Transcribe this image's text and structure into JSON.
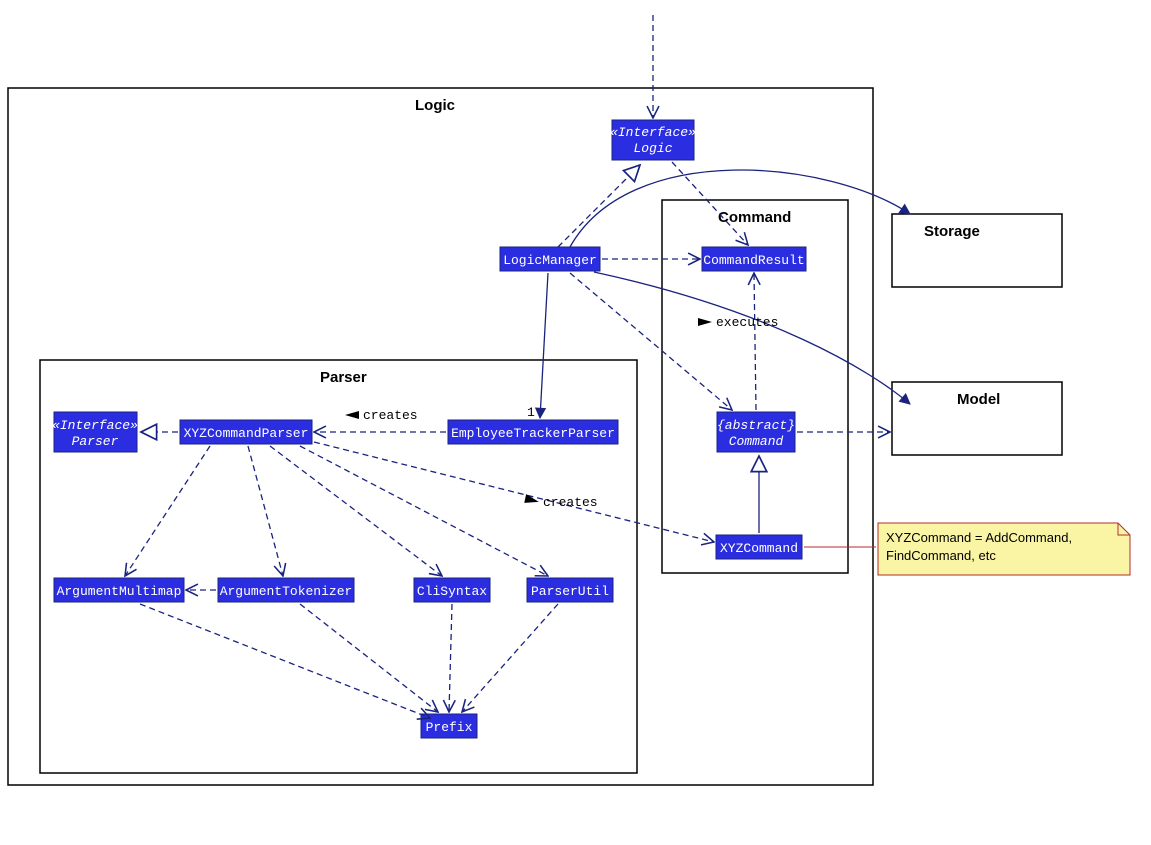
{
  "packages": {
    "logic": {
      "label": "Logic"
    },
    "parser": {
      "label": "Parser"
    },
    "command": {
      "label": "Command"
    }
  },
  "external": {
    "storage": {
      "label": "Storage"
    },
    "model": {
      "label": "Model"
    }
  },
  "classes": {
    "logic_iface": {
      "stereotype": "«Interface»",
      "name": "Logic"
    },
    "logic_manager": {
      "name": "LogicManager"
    },
    "command_result": {
      "name": "CommandResult"
    },
    "abstract_command": {
      "stereotype": "{abstract}",
      "name": "Command"
    },
    "xyz_command": {
      "name": "XYZCommand"
    },
    "parser_iface": {
      "stereotype": "«Interface»",
      "name": "Parser"
    },
    "xyz_cmd_parser": {
      "name": "XYZCommandParser"
    },
    "employee_tracker_parser": {
      "name": "EmployeeTrackerParser"
    },
    "arg_multimap": {
      "name": "ArgumentMultimap"
    },
    "arg_tokenizer": {
      "name": "ArgumentTokenizer"
    },
    "cli_syntax": {
      "name": "CliSyntax"
    },
    "parser_util": {
      "name": "ParserUtil"
    },
    "prefix": {
      "name": "Prefix"
    }
  },
  "edges": {
    "executes": {
      "label": "executes"
    },
    "creates1": {
      "label": "creates"
    },
    "creates2": {
      "label": "creates"
    },
    "mult_one": {
      "label": "1"
    }
  },
  "note": {
    "line1": "XYZCommand = AddCommand,",
    "line2": "FindCommand, etc"
  }
}
